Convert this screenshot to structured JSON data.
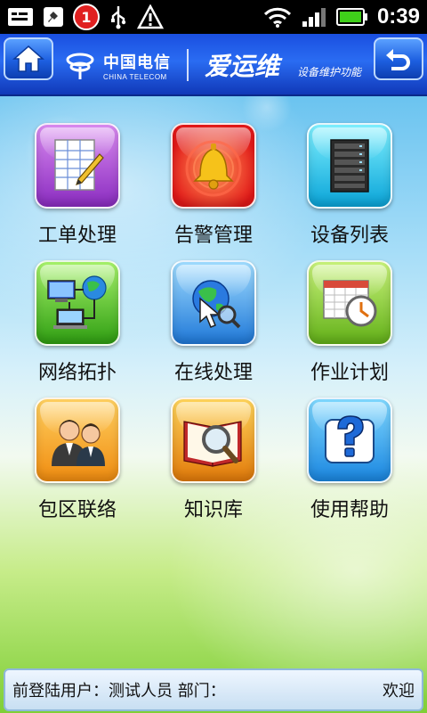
{
  "status_bar": {
    "notification_count": "1",
    "time": "0:39",
    "icons": [
      "sms-icon",
      "missed-call-icon",
      "alarm-icon",
      "usb-icon",
      "warning-icon",
      "wifi-icon",
      "signal-icon",
      "battery-icon"
    ]
  },
  "header": {
    "carrier_name_cn": "中国电信",
    "carrier_name_en": "CHINA TELECOM",
    "app_name": "爱运维",
    "app_subtitle": "设备维护功能",
    "accent_color": "#1a4fe0"
  },
  "menu": [
    {
      "label": "工单处理",
      "icon": "work-order-icon"
    },
    {
      "label": "告警管理",
      "icon": "alarm-bell-icon"
    },
    {
      "label": "设备列表",
      "icon": "server-rack-icon"
    },
    {
      "label": "网络拓扑",
      "icon": "network-topology-icon"
    },
    {
      "label": "在线处理",
      "icon": "online-processing-icon"
    },
    {
      "label": "作业计划",
      "icon": "job-plan-icon"
    },
    {
      "label": "包区联络",
      "icon": "contacts-icon"
    },
    {
      "label": "知识库",
      "icon": "knowledge-base-icon"
    },
    {
      "label": "使用帮助",
      "icon": "help-icon"
    }
  ],
  "footer": {
    "user_info": "前登陆用户：测试人员  部门：",
    "welcome": "欢迎"
  }
}
